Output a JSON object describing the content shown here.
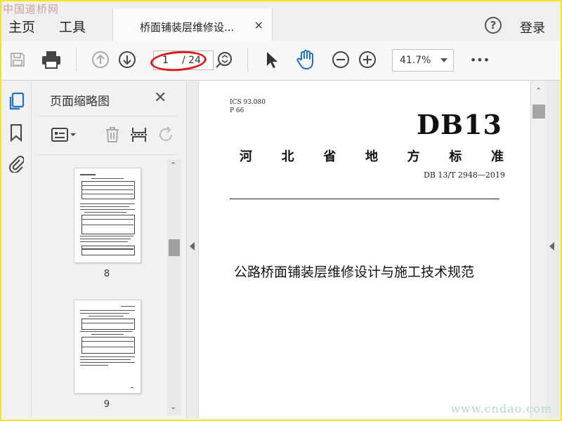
{
  "watermarks": {
    "top": "中国道桥网",
    "bottom": "www.cndao.com"
  },
  "menu": {
    "home": "主页",
    "tools": "工具",
    "login": "登录",
    "help_icon": "help-icon"
  },
  "tab": {
    "title": "桥面铺装层维修设...",
    "close": "×"
  },
  "toolbar": {
    "page_current": "1",
    "page_total": "/ 24",
    "zoom": "41.7%",
    "more": "•••",
    "icons": [
      "save-icon",
      "print-icon",
      "prev-page-icon",
      "next-page-icon",
      "find-icon",
      "select-tool-icon",
      "hand-tool-icon",
      "zoom-out-icon",
      "zoom-in-icon",
      "more-icon"
    ],
    "highlight_color": "#d32020"
  },
  "sidebar": {
    "icons": [
      "page-thumbnails-icon",
      "bookmark-icon",
      "attachment-icon"
    ],
    "accent": "#1d6fc2"
  },
  "thumbnails": {
    "title": "页面缩略图",
    "close": "✕",
    "pages": [
      {
        "label": "8"
      },
      {
        "label": "9"
      }
    ]
  },
  "document": {
    "ics": "ICS 93.080",
    "p": "P 66",
    "code_big": "DB13",
    "standard_name": [
      "河",
      "北",
      "省",
      "地",
      "方",
      "标",
      "准"
    ],
    "standard_code": "DB 13/T 2948—2019",
    "title": "公路桥面铺装层维修设计与施工技术规范"
  },
  "colors": {
    "frame": "#f5e31c",
    "toolbar_bg": "#f7f7f7",
    "panel_bg": "#f1f1f1"
  }
}
